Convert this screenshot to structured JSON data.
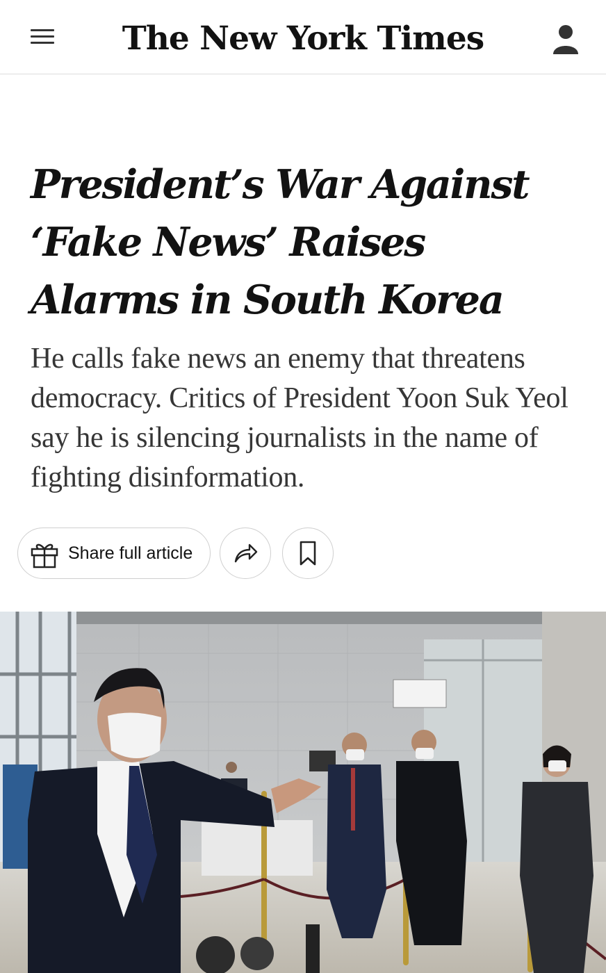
{
  "masthead": {
    "logo_text": "The New York Times",
    "menu_icon": "hamburger-menu-icon",
    "account_icon": "person-icon"
  },
  "article": {
    "headline": "President’s War Against ‘Fake News’ Raises Alarms in South Korea",
    "summary": "He calls fake news an enemy that threatens democracy. Critics of President Yoon Suk Yeol say he is silencing journalists in the name of fighting disinformation."
  },
  "actions": {
    "share_label": "Share full article",
    "share_icon": "gift-icon",
    "forward_icon": "share-arrow-icon",
    "bookmark_icon": "bookmark-icon"
  },
  "colors": {
    "text": "#121212",
    "summary_text": "#363636",
    "border": "#cfcfcf"
  }
}
